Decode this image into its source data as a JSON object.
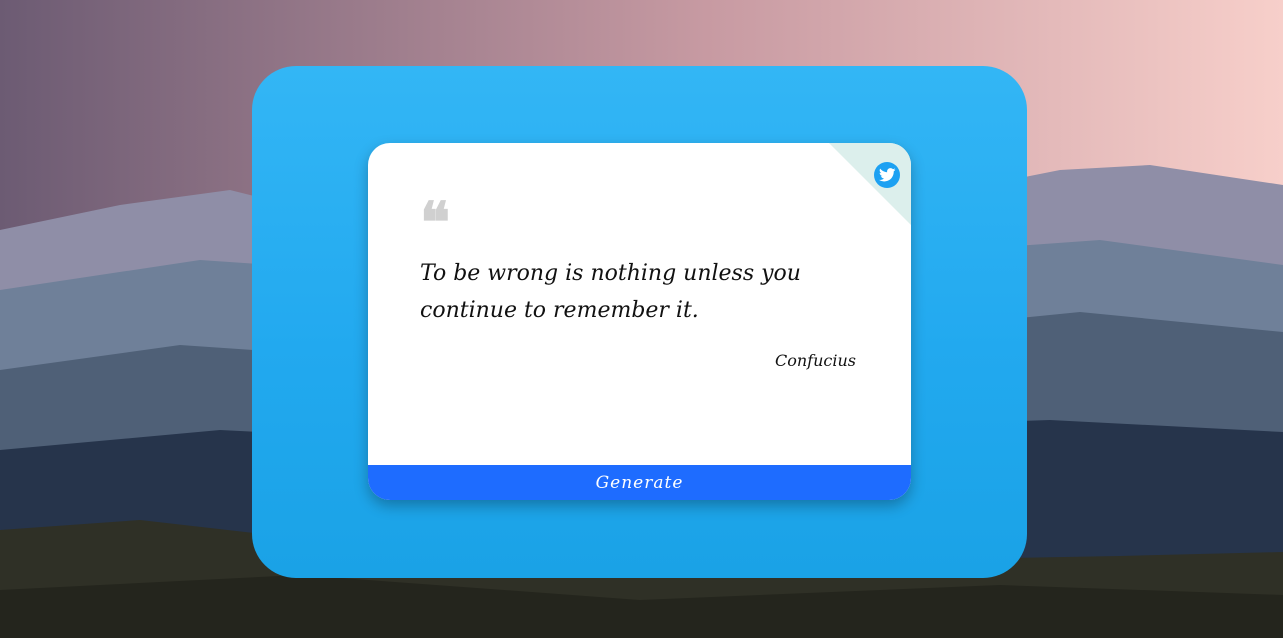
{
  "quote": {
    "text": "To be wrong is nothing unless you continue to remember it.",
    "author": "Confucius",
    "mark": "❝"
  },
  "actions": {
    "generate_label": "Generate"
  },
  "icons": {
    "tweet": "twitter-icon",
    "quote": "quote-icon"
  },
  "colors": {
    "panel": "#22a9ef",
    "card": "#ffffff",
    "generate_button": "#1e6cff",
    "twitter": "#1da1f2",
    "corner_fold": "#dcefec"
  }
}
